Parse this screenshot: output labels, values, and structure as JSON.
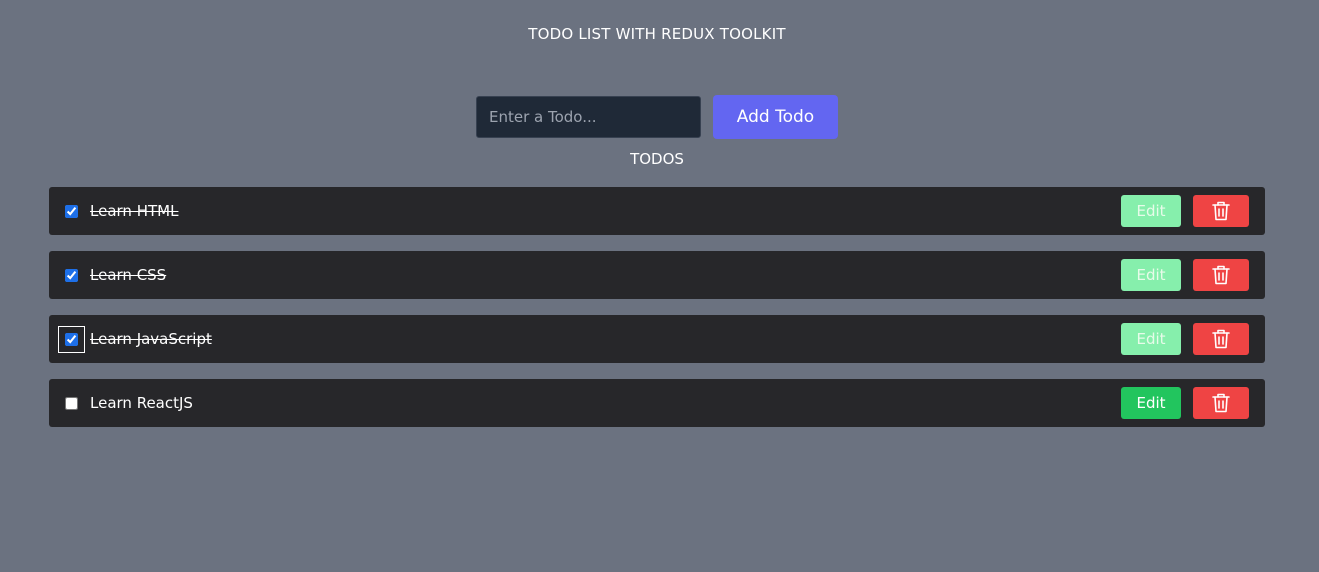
{
  "app": {
    "title": "TODO LIST WITH REDUX TOOLKIT"
  },
  "form": {
    "input_value": "",
    "input_placeholder": "Enter a Todo...",
    "add_label": "Add Todo"
  },
  "list": {
    "title": "TODOS",
    "items": [
      {
        "text": "Learn HTML",
        "completed": true,
        "edit_label": "Edit",
        "edit_enabled": false
      },
      {
        "text": "Learn CSS",
        "completed": true,
        "edit_label": "Edit",
        "edit_enabled": false
      },
      {
        "text": "Learn JavaScript",
        "completed": true,
        "edit_label": "Edit",
        "edit_enabled": false,
        "focused": true
      },
      {
        "text": "Learn ReactJS",
        "completed": false,
        "edit_label": "Edit",
        "edit_enabled": true
      }
    ],
    "delete_icon": "trash-icon"
  },
  "colors": {
    "background": "#6b7280",
    "row_background": "#27272a",
    "input_background": "#1f2937",
    "add_button": "#6366f1",
    "edit_enabled": "#22c55e",
    "edit_disabled": "#86efac",
    "delete_button": "#ef4444",
    "checkbox": "#1d6fe8"
  }
}
